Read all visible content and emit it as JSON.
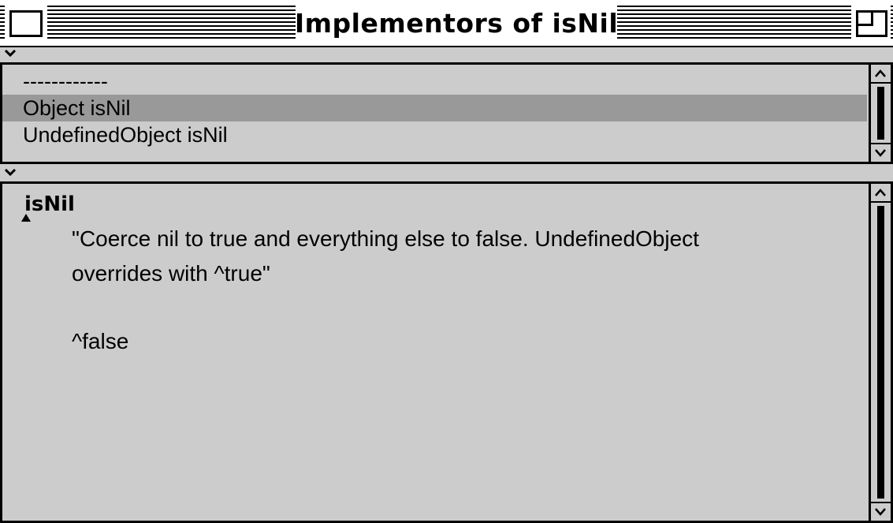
{
  "window": {
    "title": "Implementors of isNil"
  },
  "list": {
    "items": [
      {
        "label": "------------",
        "selected": false
      },
      {
        "label": "Object isNil",
        "selected": true
      },
      {
        "label": "UndefinedObject isNil",
        "selected": false
      }
    ]
  },
  "code": {
    "selector": "isNil",
    "comment_line1": "\"Coerce nil to true and everything else to false. UndefinedObject",
    "comment_line2": "overrides with ^true\"",
    "return_line": "^false"
  },
  "icons": {
    "close": "close-box-icon",
    "zoom": "zoom-box-icon",
    "menu": "chevron-down-icon",
    "scroll_up": "arrow-up-icon",
    "scroll_down": "arrow-down-icon"
  },
  "colors": {
    "background": "#cccccc",
    "selection": "#999999",
    "frame": "#000000"
  }
}
